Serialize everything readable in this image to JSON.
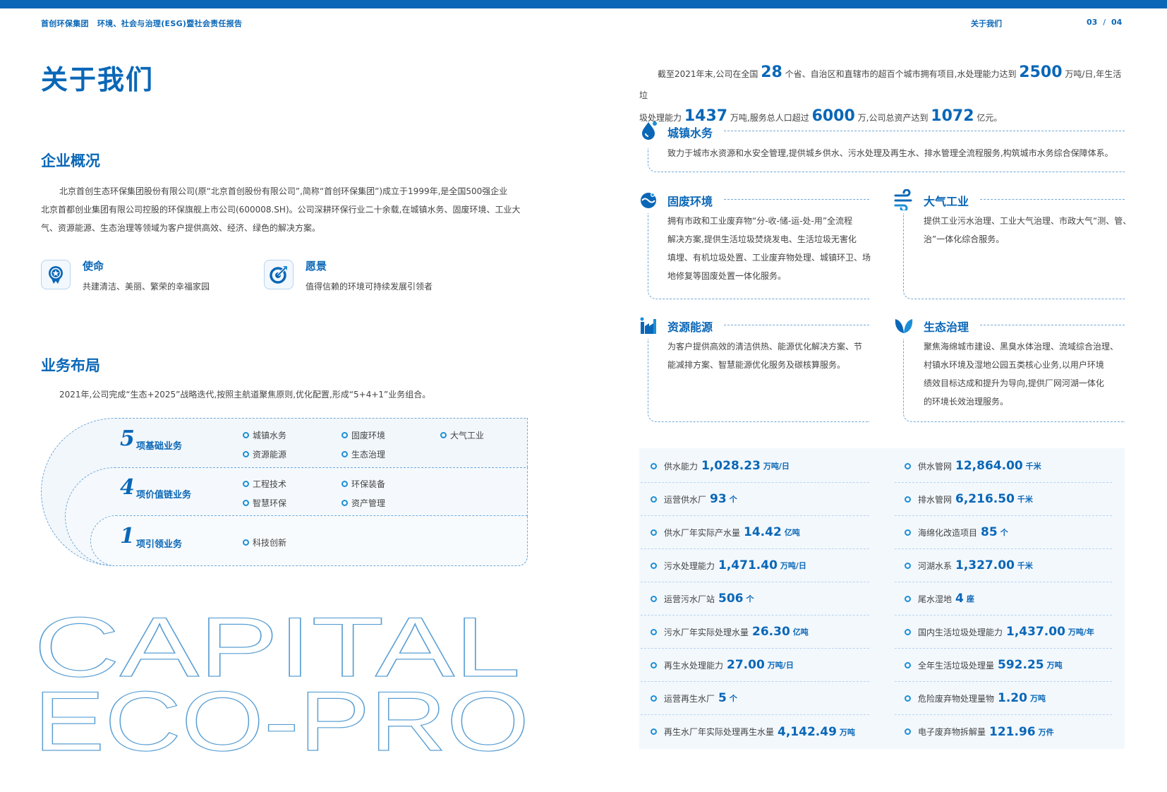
{
  "header": {
    "brand": "首创环保集团",
    "report": "环境、社会与治理(ESG)暨社会责任报告",
    "section": "关于我们",
    "page_left": "03",
    "page_sep": "/",
    "page_right": "04"
  },
  "page_title": "关于我们",
  "overview": {
    "heading": "企业概况",
    "lines": [
      "北京首创生态环保集团股份有限公司(原“北京首创股份有限公司”,简称“首创环保集团”)成立于1999年,是全国500强企业",
      "北京首都创业集团有限公司控股的环保旗舰上市公司(600008.SH)。公司深耕环保行业二十余载,在城镇水务、固废环境、工业大",
      "气、资源能源、生态治理等领域为客户提供高效、经济、绿色的解决方案。"
    ],
    "mission": {
      "title": "使命",
      "text": "共建清洁、美丽、繁荣的幸福家园",
      "icon": "medal-icon"
    },
    "vision": {
      "title": "愿景",
      "text": "值得信赖的环境可持续发展引领者",
      "icon": "target-icon"
    }
  },
  "business": {
    "heading": "业务布局",
    "intro": "2021年,公司完成“生态+2025”战略迭代,按照主航道聚焦原则,优化配置,形成“5+4+1”业务组合。",
    "tiers": [
      {
        "num": "5",
        "label": "项基础业务",
        "items": [
          "城镇水务",
          "固废环境",
          "大气工业",
          "资源能源",
          "生态治理"
        ]
      },
      {
        "num": "4",
        "label": "项价值链业务",
        "items": [
          "工程技术",
          "环保装备",
          "智慧环保",
          "资产管理"
        ]
      },
      {
        "num": "1",
        "label": "项引领业务",
        "items": [
          "科技创新"
        ]
      }
    ]
  },
  "watermark": {
    "line1": "CAPITAL",
    "line2": "ECO-PRO"
  },
  "lead": {
    "t1": "截至2021年末,公司在全国",
    "n1": "28",
    "t2": "个省、自治区和直辖市的超百个城市拥有项目,水处理能力达到",
    "n2": "2500",
    "t3": "万吨/日,年生活垃",
    "t4": "圾处理能力",
    "n3": "1437",
    "t5": "万吨,服务总人口超过",
    "n4": "6000",
    "t6": "万,公司总资产达到",
    "n5": "1072",
    "t7": "亿元。"
  },
  "segments": [
    {
      "title": "城镇水务",
      "icon": "water-drop-icon",
      "lines": [
        "致力于城市水资源和水安全管理,提供城乡供水、污水处理及再生水、排水管理全流程服务,构筑城市水务综合保障体系。"
      ]
    },
    {
      "title": "固废环境",
      "icon": "solid-waste-icon",
      "lines": [
        "拥有市政和工业废弃物“分-收-储-运-处-用”全流程",
        "解决方案,提供生活垃圾焚烧发电、生活垃圾无害化",
        "填埋、有机垃圾处置、工业废弃物处理、城镇环卫、场",
        "地修复等固废处置一体化服务。"
      ]
    },
    {
      "title": "大气工业",
      "icon": "wind-icon",
      "lines": [
        "提供工业污水治理、工业大气治理、市政大气“测、管、",
        "治”一体化综合服务。"
      ]
    },
    {
      "title": "资源能源",
      "icon": "factory-icon",
      "lines": [
        "为客户提供高效的清洁供热、能源优化解决方案、节",
        "能减排方案、智慧能源优化服务及碳核算服务。"
      ]
    },
    {
      "title": "生态治理",
      "icon": "leaf-icon",
      "lines": [
        "聚焦海绵城市建设、黑臭水体治理、流域综合治理、",
        "村镇水环境及湿地公园五类核心业务,以用户环境",
        "绩效目标达成和提升为导向,提供厂网河湖一体化",
        "的环境长效治理服务。"
      ]
    }
  ],
  "stats": {
    "left": [
      {
        "label": "供水能力",
        "value": "1,028.23",
        "unit": "万吨/日"
      },
      {
        "label": "运营供水厂",
        "value": "93",
        "unit": "个"
      },
      {
        "label": "供水厂年实际产水量",
        "value": "14.42",
        "unit": "亿吨"
      },
      {
        "label": "污水处理能力",
        "value": "1,471.40",
        "unit": "万吨/日"
      },
      {
        "label": "运营污水厂站",
        "value": "506",
        "unit": "个"
      },
      {
        "label": "污水厂年实际处理水量",
        "value": "26.30",
        "unit": "亿吨"
      },
      {
        "label": "再生水处理能力",
        "value": "27.00",
        "unit": "万吨/日"
      },
      {
        "label": "运营再生水厂",
        "value": "5",
        "unit": "个"
      },
      {
        "label": "再生水厂年实际处理再生水量",
        "value": "4,142.49",
        "unit": "万吨"
      }
    ],
    "right": [
      {
        "label": "供水管网",
        "value": "12,864.00",
        "unit": "千米"
      },
      {
        "label": "排水管网",
        "value": "6,216.50",
        "unit": "千米"
      },
      {
        "label": "海绵化改造项目",
        "value": "85",
        "unit": "个"
      },
      {
        "label": "河湖水系",
        "value": "1,327.00",
        "unit": "千米"
      },
      {
        "label": "尾水湿地",
        "value": "4",
        "unit": "座"
      },
      {
        "label": "国内生活垃圾处理能力",
        "value": "1,437.00",
        "unit": "万吨/年"
      },
      {
        "label": "全年生活垃圾处理量",
        "value": "592.25",
        "unit": "万吨"
      },
      {
        "label": "危险废弃物处理量物",
        "value": "1.20",
        "unit": "万吨"
      },
      {
        "label": "电子废弃物拆解量",
        "value": "121.96",
        "unit": "万件"
      }
    ]
  },
  "colors": {
    "primary": "#0a67b7",
    "accent": "#1b8fd6",
    "panel": "#f3f8fd"
  }
}
